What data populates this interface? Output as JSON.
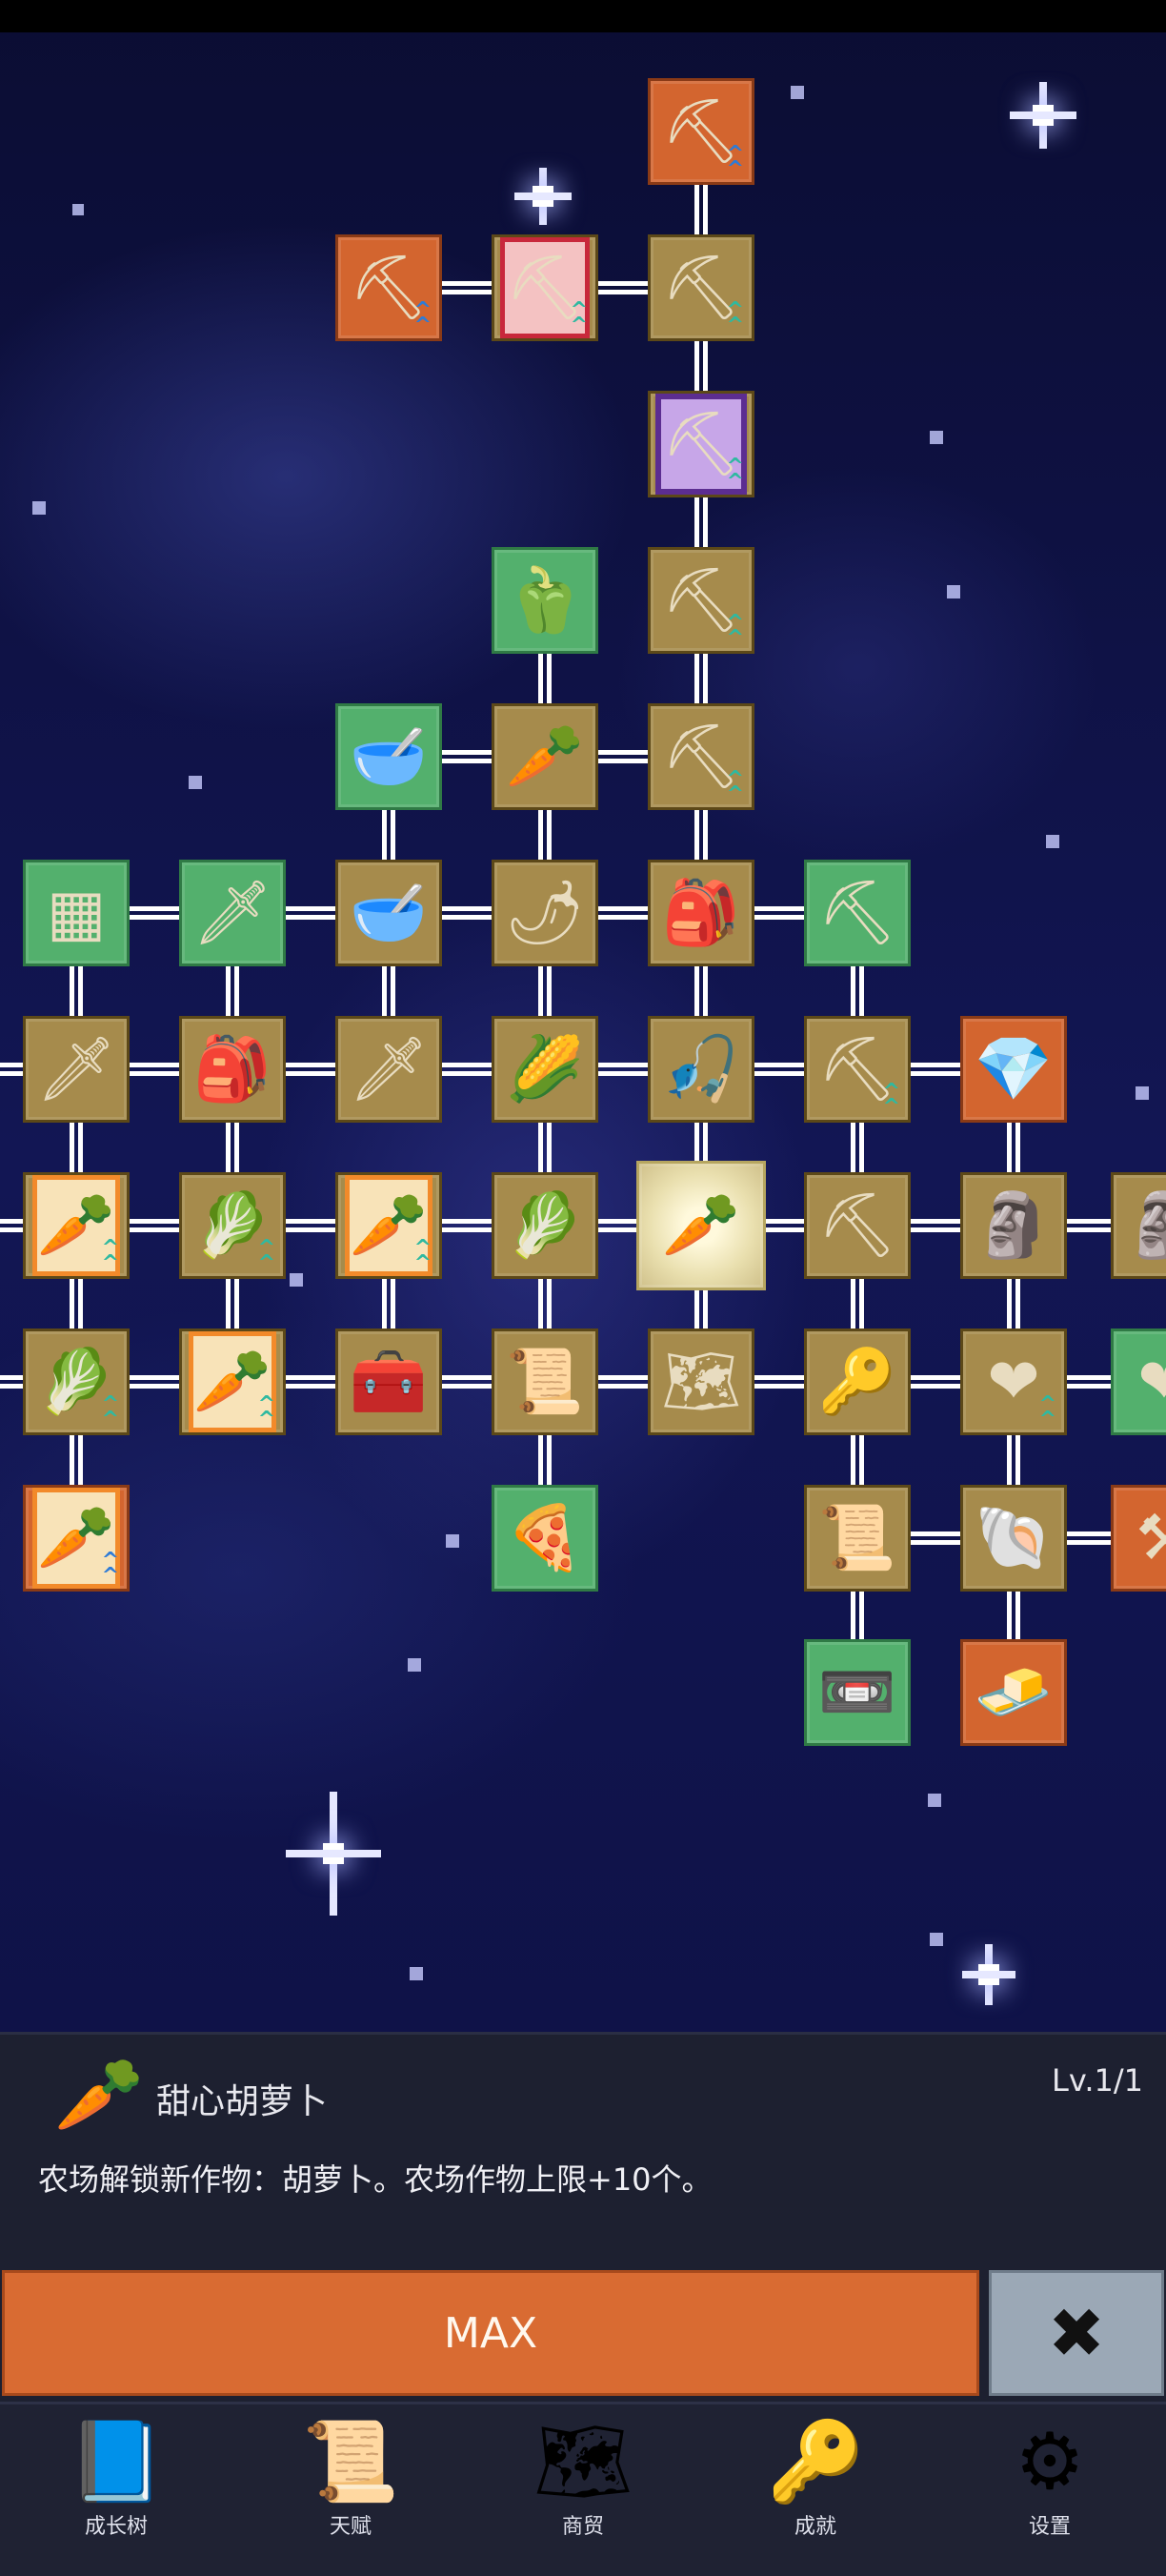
{
  "skill_tree": {
    "nodes": [
      {
        "id": "n1",
        "icon": "shovel-icon",
        "glyph": "⛏",
        "style": "orange",
        "chev": "blue",
        "selected": false
      },
      {
        "id": "n2",
        "icon": "shovel-icon",
        "glyph": "⛏",
        "style": "orange",
        "chev": "blue"
      },
      {
        "id": "n3",
        "icon": "shovel-icon",
        "glyph": "⛏",
        "style": "gold framed-red",
        "chev": "green"
      },
      {
        "id": "n4",
        "icon": "shovel-icon",
        "glyph": "⛏",
        "style": "gold",
        "chev": "green"
      },
      {
        "id": "n5",
        "icon": "shovel-icon",
        "glyph": "⛏",
        "style": "gold framed-purple",
        "chev": "green"
      },
      {
        "id": "n6",
        "icon": "pepper-icon",
        "glyph": "🫑",
        "style": "green",
        "chev": ""
      },
      {
        "id": "n7",
        "icon": "shovel-icon",
        "glyph": "⛏",
        "style": "gold",
        "chev": "green"
      },
      {
        "id": "n8",
        "icon": "bowl-icon",
        "glyph": "🥣",
        "style": "green",
        "chev": ""
      },
      {
        "id": "n9",
        "icon": "radish-icon",
        "glyph": "🥕",
        "style": "gold",
        "chev": ""
      },
      {
        "id": "n10",
        "icon": "shovel-icon",
        "glyph": "⛏",
        "style": "gold",
        "chev": "green"
      },
      {
        "id": "n11",
        "icon": "crate-icon",
        "glyph": "▦",
        "style": "green",
        "chev": ""
      },
      {
        "id": "n12",
        "icon": "sword-icon",
        "glyph": "🗡",
        "style": "green",
        "chev": ""
      },
      {
        "id": "n13",
        "icon": "bowl-icon",
        "glyph": "🥣",
        "style": "gold",
        "chev": ""
      },
      {
        "id": "n14",
        "icon": "chili-icon",
        "glyph": "🌶",
        "style": "gold",
        "chev": ""
      },
      {
        "id": "n15",
        "icon": "backpack-icon",
        "glyph": "🎒",
        "style": "gold",
        "chev": ""
      },
      {
        "id": "n16",
        "icon": "pickaxe-icon",
        "glyph": "⛏",
        "style": "green",
        "chev": ""
      },
      {
        "id": "n17",
        "icon": "sword-icon",
        "glyph": "🗡",
        "style": "gold",
        "chev": ""
      },
      {
        "id": "n18",
        "icon": "backpack-icon",
        "glyph": "🎒",
        "style": "gold",
        "chev": ""
      },
      {
        "id": "n19",
        "icon": "sword-icon",
        "glyph": "🗡",
        "style": "gold",
        "chev": ""
      },
      {
        "id": "n20",
        "icon": "corn-icon",
        "glyph": "🌽",
        "style": "gold",
        "chev": ""
      },
      {
        "id": "n21",
        "icon": "fishing-rod-icon",
        "glyph": "🎣",
        "style": "gold",
        "chev": ""
      },
      {
        "id": "n22",
        "icon": "pickaxe-icon",
        "glyph": "⛏",
        "style": "gold",
        "chev": "green"
      },
      {
        "id": "n23",
        "icon": "crystal-icon",
        "glyph": "💎",
        "style": "orange",
        "chev": ""
      },
      {
        "id": "n24",
        "icon": "carrot-icon",
        "glyph": "🥕",
        "style": "gold framed",
        "chev": "green"
      },
      {
        "id": "n25",
        "icon": "cabbage-icon",
        "glyph": "🥬",
        "style": "gold",
        "chev": "green"
      },
      {
        "id": "n26",
        "icon": "carrot-icon",
        "glyph": "🥕",
        "style": "gold framed",
        "chev": "green"
      },
      {
        "id": "n27",
        "icon": "cabbage-icon",
        "glyph": "🥬",
        "style": "gold",
        "chev": ""
      },
      {
        "id": "n28",
        "icon": "carrot-icon",
        "glyph": "🥕",
        "style": "selected",
        "chev": ""
      },
      {
        "id": "n29",
        "icon": "pickaxe-icon",
        "glyph": "⛏",
        "style": "gold",
        "chev": ""
      },
      {
        "id": "n30",
        "icon": "statue-icon",
        "glyph": "🗿",
        "style": "gold",
        "chev": ""
      },
      {
        "id": "n31",
        "icon": "statue-icon",
        "glyph": "🗿",
        "style": "gold",
        "chev": ""
      },
      {
        "id": "n32",
        "icon": "cabbage-icon",
        "glyph": "🥬",
        "style": "gold",
        "chev": "green"
      },
      {
        "id": "n33",
        "icon": "carrot-icon",
        "glyph": "🥕",
        "style": "gold framed",
        "chev": "green"
      },
      {
        "id": "n34",
        "icon": "chest-icon",
        "glyph": "🧰",
        "style": "gold",
        "chev": ""
      },
      {
        "id": "n35",
        "icon": "scroll-icon",
        "glyph": "📜",
        "style": "gold",
        "chev": ""
      },
      {
        "id": "n36",
        "icon": "map-icon",
        "glyph": "🗺",
        "style": "gold",
        "chev": ""
      },
      {
        "id": "n37",
        "icon": "key-icon",
        "glyph": "🔑",
        "style": "gold",
        "chev": ""
      },
      {
        "id": "n38",
        "icon": "heart-icon",
        "glyph": "❤",
        "style": "gold",
        "chev": "green"
      },
      {
        "id": "n39",
        "icon": "heart-icon",
        "glyph": "❤",
        "style": "green",
        "chev": ""
      },
      {
        "id": "n40",
        "icon": "carrot-icon",
        "glyph": "🥕",
        "style": "orange framed",
        "chev": "blue"
      },
      {
        "id": "n41",
        "icon": "pizza-icon",
        "glyph": "🍕",
        "style": "green",
        "chev": ""
      },
      {
        "id": "n42",
        "icon": "scroll-icon",
        "glyph": "📜",
        "style": "gold",
        "chev": ""
      },
      {
        "id": "n43",
        "icon": "fossil-icon",
        "glyph": "🐚",
        "style": "gold",
        "chev": ""
      },
      {
        "id": "n44",
        "icon": "tool-icon",
        "glyph": "⚒",
        "style": "orange",
        "chev": ""
      },
      {
        "id": "n45",
        "icon": "cassette-icon",
        "glyph": "📼",
        "style": "green",
        "chev": ""
      },
      {
        "id": "n46",
        "icon": "gold-bar-icon",
        "glyph": "🧈",
        "style": "orange",
        "chev": ""
      }
    ]
  },
  "detail": {
    "icon": "carrot-icon",
    "glyph": "🥕",
    "name": "甜心胡萝卜",
    "level": "Lv.1/1",
    "description": "农场解锁新作物：胡萝卜。农场作物上限+10个。",
    "max_label": "MAX",
    "close_glyph": "✖"
  },
  "nav": [
    {
      "id": "growth-tree",
      "label": "成长树",
      "icon": "book-icon",
      "glyph": "📘"
    },
    {
      "id": "talent",
      "label": "天赋",
      "icon": "scroll-icon",
      "glyph": "📜"
    },
    {
      "id": "trade",
      "label": "商贸",
      "icon": "map-icon",
      "glyph": "🗺"
    },
    {
      "id": "achievement",
      "label": "成就",
      "icon": "key-icon",
      "glyph": "🔑"
    },
    {
      "id": "settings",
      "label": "设置",
      "icon": "gear-icon",
      "glyph": "⚙"
    }
  ]
}
